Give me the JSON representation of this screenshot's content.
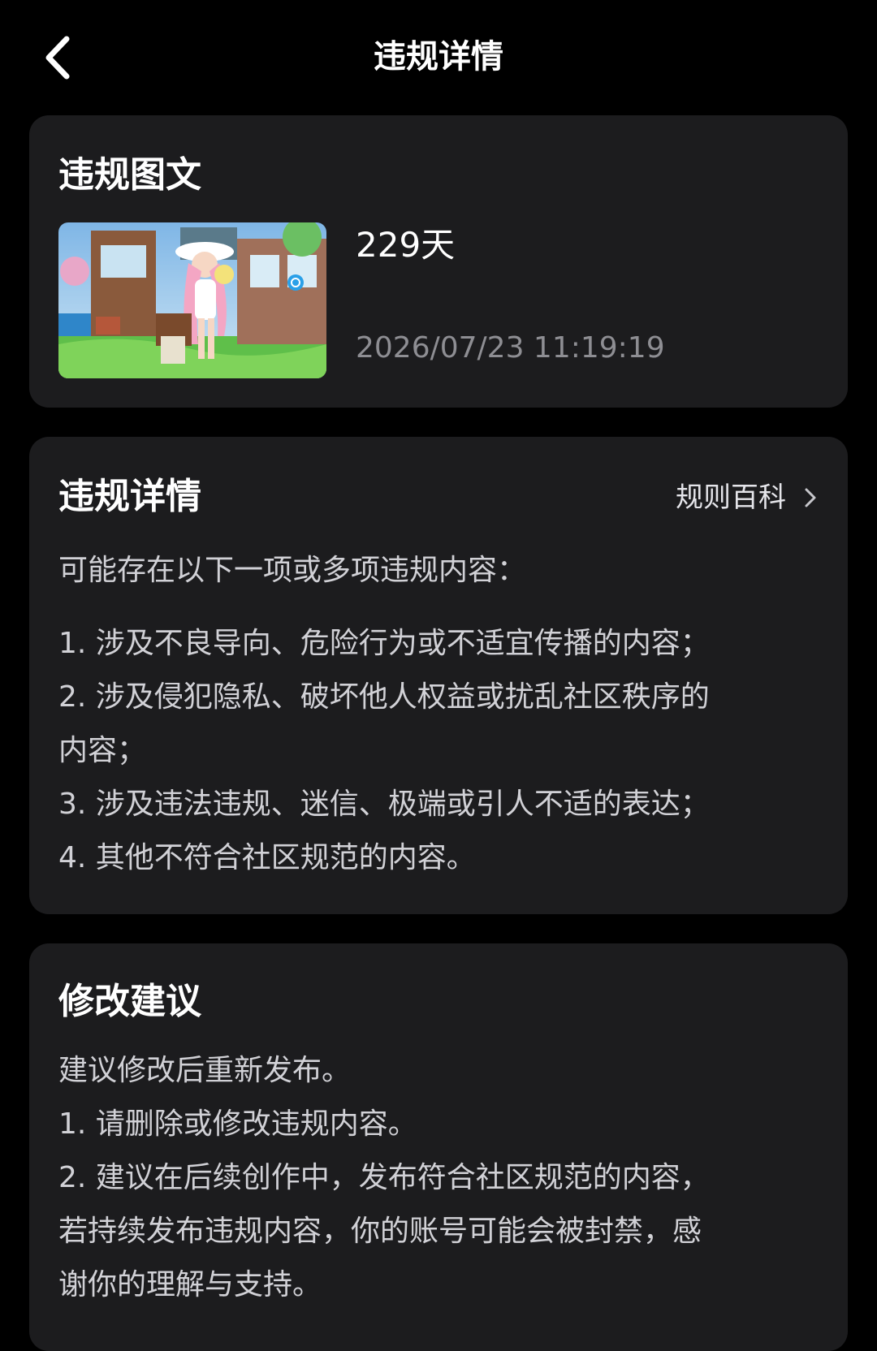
{
  "nav": {
    "title": "违规详情",
    "back_icon": "chevron-left-icon"
  },
  "post_card": {
    "title": "违规图文",
    "days": "229天",
    "timestamp": "2026/07/23 11:19:19"
  },
  "detail_card": {
    "title": "违规详情",
    "rules_link": "规则百科",
    "intro": "可能存在以下一项或多项违规内容：",
    "items": [
      "1. 涉及不良导向、危险行为或不适宜传播的内容；",
      "2. 涉及侵犯隐私、破坏他人权益或扰乱社区秩序的",
      "内容；",
      "3. 涉及违法违规、迷信、极端或引人不适的表达；",
      "4. 其他不符合社区规范的内容。"
    ]
  },
  "advice_card": {
    "title": "修改建议",
    "lines": [
      "建议修改后重新发布。",
      "1. 请删除或修改违规内容。",
      "2. 建议在后续创作中，发布符合社区规范的内容，",
      "若持续发布违规内容，你的账号可能会被封禁，感",
      "谢你的理解与支持。"
    ]
  },
  "colors": {
    "background": "#000000",
    "card": "#1c1c1e",
    "primary_text": "#ffffff",
    "secondary_text": "#8e8e93",
    "body_text": "#d1d1d6"
  }
}
